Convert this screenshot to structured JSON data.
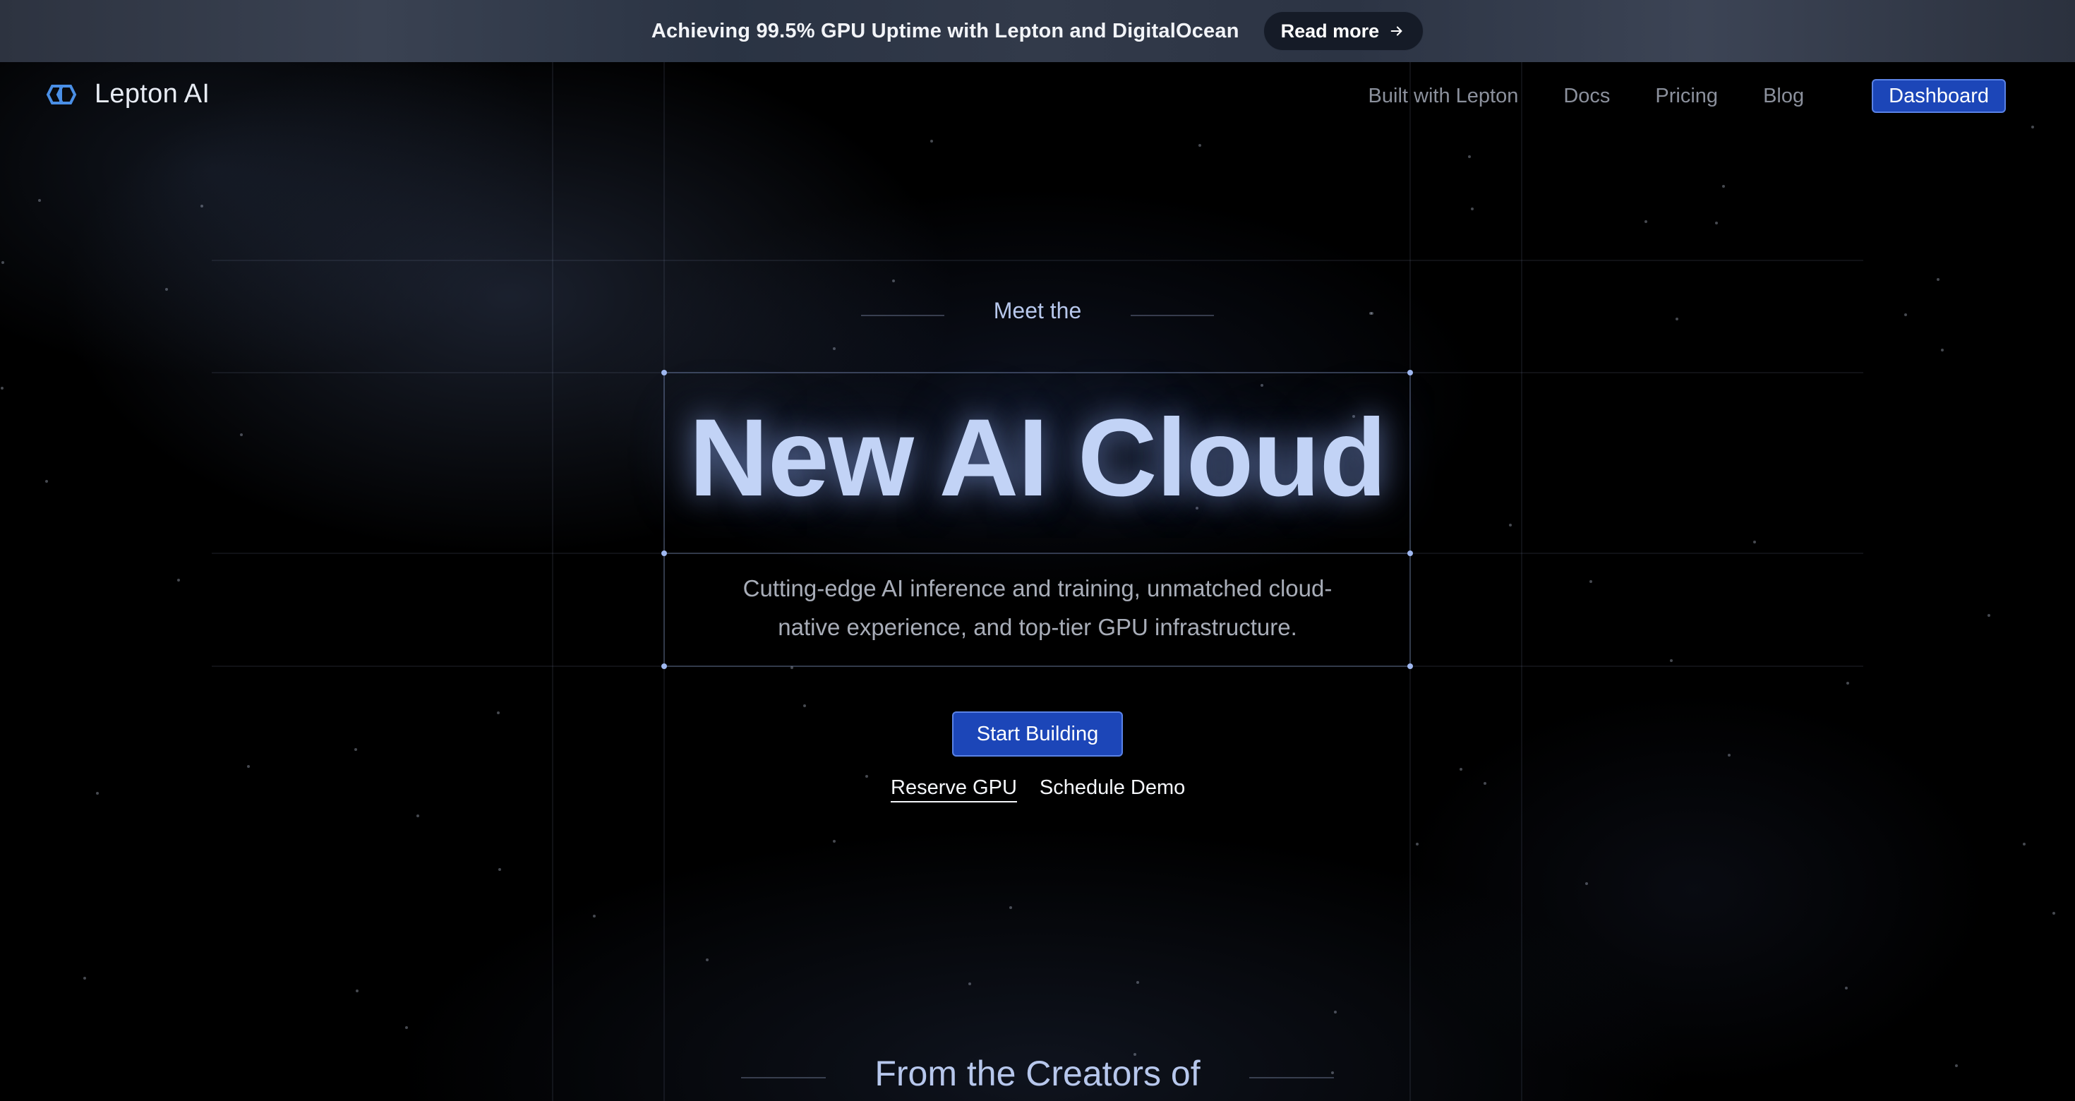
{
  "banner": {
    "text": "Achieving 99.5% GPU Uptime with Lepton and DigitalOcean",
    "cta_label": "Read more",
    "cta_icon": "arrow-right-icon"
  },
  "nav": {
    "logo_text": "Lepton AI",
    "logo_icon": "lepton-logo-icon",
    "links": [
      "Built with Lepton",
      "Docs",
      "Pricing",
      "Blog"
    ],
    "dashboard_label": "Dashboard"
  },
  "hero": {
    "eyebrow": "Meet the",
    "title": "New AI Cloud",
    "subtitle_line1": "Cutting-edge AI inference and training, unmatched cloud-",
    "subtitle_line2": "native experience, and top-tier GPU infrastructure.",
    "primary_cta": "Start Building",
    "secondary_links": [
      "Reserve GPU",
      "Schedule Demo"
    ]
  },
  "next_section": {
    "heading": "From the Creators of"
  },
  "colors": {
    "accent_button": "#1c46b8",
    "accent_border": "#5a82e6",
    "title_blue": "#c2d3f6",
    "background": "#000000"
  }
}
